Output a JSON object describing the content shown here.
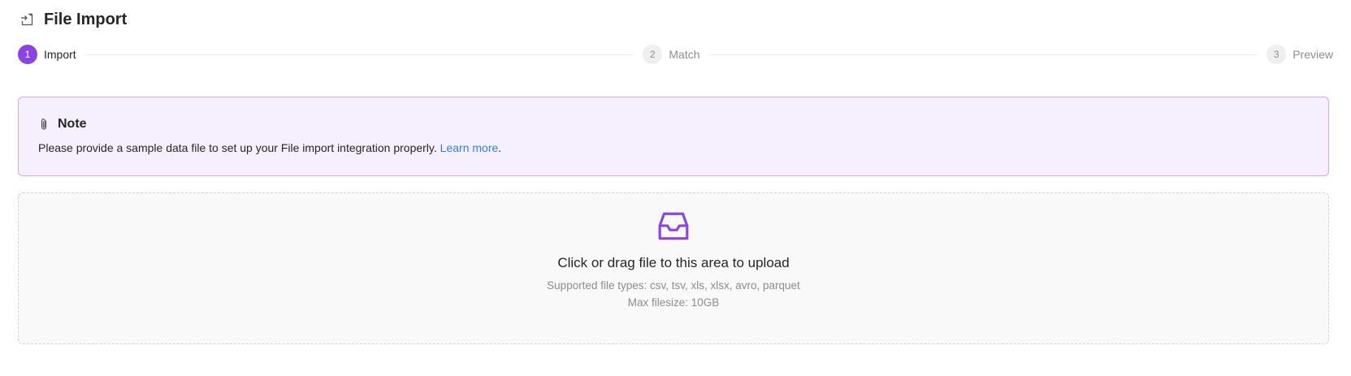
{
  "header": {
    "title": "File Import",
    "icon": "import-icon"
  },
  "steps": [
    {
      "number": "1",
      "label": "Import",
      "state": "active"
    },
    {
      "number": "2",
      "label": "Match",
      "state": "inactive"
    },
    {
      "number": "3",
      "label": "Preview",
      "state": "inactive"
    }
  ],
  "note": {
    "icon": "paperclip-icon",
    "title": "Note",
    "text": "Please provide a sample data file to set up your File import integration properly.",
    "link_text": "Learn more",
    "suffix": "."
  },
  "upload": {
    "icon": "inbox-icon",
    "title": "Click or drag file to this area to upload",
    "supported": "Supported file types: csv, tsv, xls, xlsx, avro, parquet",
    "max_size": "Max filesize: 10GB"
  },
  "colors": {
    "accent": "#8b44e0",
    "note_bg": "#f6effd",
    "note_border": "#d9a5f2",
    "link": "#2f7fe0"
  }
}
